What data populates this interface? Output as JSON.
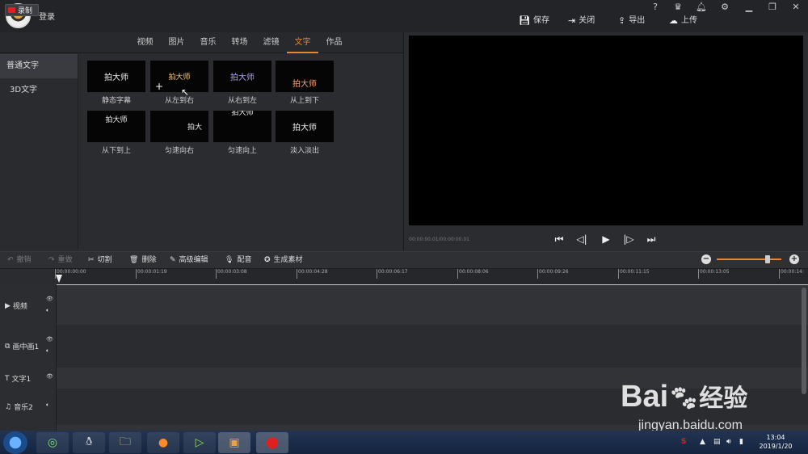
{
  "titlebar": {
    "login": "登录",
    "help_icon": "?",
    "save": "保存",
    "close": "关闭",
    "export": "导出",
    "upload": "上传"
  },
  "top": {
    "record": "录制",
    "tabs": [
      "视频",
      "图片",
      "音乐",
      "转场",
      "滤镜",
      "文字",
      "作品"
    ],
    "active_tab": 5
  },
  "sidenav": [
    "普通文字",
    "3D文字"
  ],
  "effects": [
    {
      "preview": "拍大师",
      "label": "静态字幕"
    },
    {
      "preview": "拍大师",
      "label": "从左到右"
    },
    {
      "preview": "拍大师",
      "label": "从右到左"
    },
    {
      "preview": "拍大师",
      "label": "从上到下"
    },
    {
      "preview": "拍大师",
      "label": "从下到上"
    },
    {
      "preview": "拍大",
      "label": "匀速向右"
    },
    {
      "preview": "拍大师",
      "label": "匀速向上"
    },
    {
      "preview": "拍大师",
      "label": "淡入淡出"
    }
  ],
  "preview": {
    "timecode": "00:00:00.01/00:00:00.01"
  },
  "toolbar": {
    "undo": "撤销",
    "redo": "重做",
    "cut": "切割",
    "delete": "删除",
    "advanced": "高级编辑",
    "dub": "配音",
    "generate": "生成素材",
    "zoom_level": 0.82
  },
  "ruler": [
    "00:00:00:00",
    "00:00:01:19",
    "00:00:03:08",
    "00:00:04:28",
    "00:00:06:17",
    "00:00:08:06",
    "00:00:09:26",
    "00:00:11:15",
    "00:00:13:05",
    "00:00:14:"
  ],
  "tracks": [
    {
      "label": "视频"
    },
    {
      "label": "画中画1"
    },
    {
      "label": "文字1"
    },
    {
      "label": "音乐2"
    }
  ],
  "taskbar": {
    "clock_time": "13:04",
    "clock_date": "2019/1/20"
  },
  "watermark": {
    "logo": "Bai",
    "logo_suffix": "经验",
    "url": "jingyan.baidu.com"
  }
}
